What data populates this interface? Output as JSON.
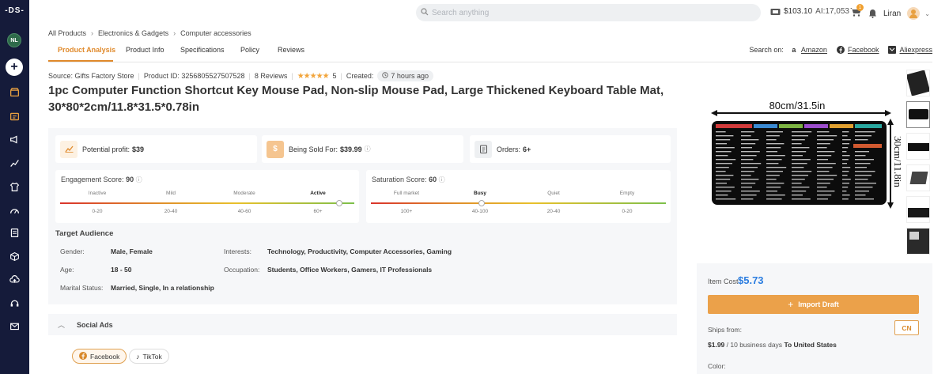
{
  "sidebar": {
    "logo": "-DS-",
    "avatar_initials": "NL",
    "plus_label": "+",
    "icons": [
      "store-icon",
      "orders-icon",
      "megaphone-icon",
      "analytics-icon",
      "shirt-icon",
      "speedometer-icon",
      "document-icon",
      "box-icon",
      "cloud-upload-icon",
      "support-icon",
      "mail-icon"
    ]
  },
  "topbar": {
    "search_placeholder": "Search anything",
    "balance": "$103.10",
    "ai_credits": "AI:17,053",
    "cart_badge": "1",
    "user_name": "Liran"
  },
  "breadcrumb": [
    "All Products",
    "Electronics & Gadgets",
    "Computer accessories"
  ],
  "tabs": [
    "Product Analysis",
    "Product Info",
    "Specifications",
    "Policy",
    "Reviews"
  ],
  "search_on": {
    "label": "Search on:",
    "links": [
      "Amazon",
      "Facebook",
      "Aliexpress"
    ]
  },
  "meta": {
    "source": "Source: Gifts Factory Store",
    "product_id": "Product ID: 3256805527507528",
    "reviews": "8 Reviews",
    "stars": "★★★★★",
    "rating": "5",
    "created_label": "Created:",
    "created_value": "7 hours ago"
  },
  "title": "1pc Computer Function Shortcut Key Mouse Pad, Non-slip Mouse Pad, Large Thickened Keyboard Table Mat, 30*80*2cm/11.8*31.5*0.78in",
  "stats": {
    "profit_label": "Potential profit:",
    "profit_value": "$39",
    "sold_label": "Being Sold For:",
    "sold_value": "$39.99",
    "orders_label": "Orders:",
    "orders_value": "6+"
  },
  "engagement": {
    "label": "Engagement Score:",
    "value": "90",
    "level": 0.95,
    "levels": [
      "Inactive",
      "Mild",
      "Moderate",
      "Active"
    ],
    "ranges": [
      "0-20",
      "20-40",
      "40-60",
      "60+"
    ]
  },
  "saturation": {
    "label": "Saturation Score:",
    "value": "60",
    "level": 0.375,
    "levels": [
      "Full market",
      "Busy",
      "Quiet",
      "Empty"
    ],
    "ranges": [
      "100+",
      "40-100",
      "20-40",
      "0-20"
    ]
  },
  "audience": {
    "title": "Target Audience",
    "gender_label": "Gender:",
    "gender": "Male, Female",
    "age_label": "Age:",
    "age": "18 - 50",
    "marital_label": "Marital Status:",
    "marital": "Married, Single, In a relationship",
    "interests_label": "Interests:",
    "interests": "Technology, Productivity, Computer Accessories, Gaming",
    "occupation_label": "Occupation:",
    "occupation": "Students, Office Workers, Gamers, IT Professionals"
  },
  "social": {
    "title": "Social Ads",
    "chips": [
      "Facebook",
      "TikTok"
    ]
  },
  "product_image": {
    "width_label": "80cm/31.5in",
    "height_label": "30cm/11.8in"
  },
  "purchase": {
    "item_cost_label": "Item Cost",
    "item_cost": "$5.73",
    "import_label": "Import Draft",
    "ships_from_label": "Ships from:",
    "ships_from": "CN",
    "shipping_price": "$1.99",
    "shipping_days": "/ 10 business days",
    "shipping_to": "To United States",
    "color_label": "Color:"
  },
  "colors": {
    "accent": "#e08a2c",
    "sidebar": "#151b3a",
    "cost": "#2b7de0"
  }
}
